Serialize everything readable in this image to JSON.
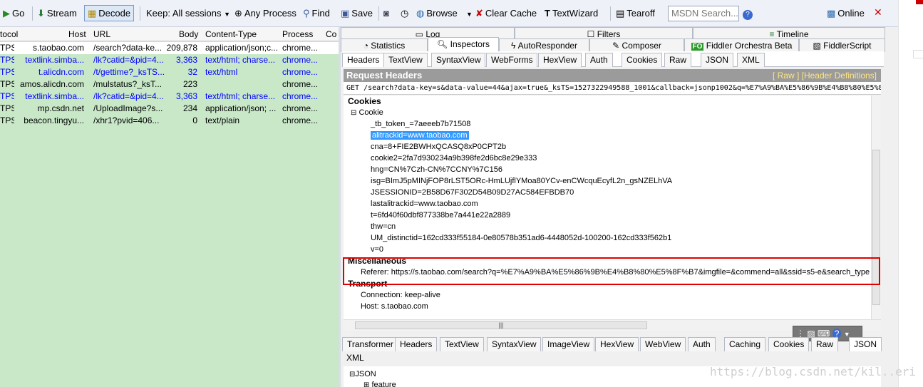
{
  "toolbar": {
    "go": "Go",
    "stream": "Stream",
    "decode": "Decode",
    "keep": "Keep: All sessions",
    "any_process": "Any Process",
    "find": "Find",
    "save": "Save",
    "browse": "Browse",
    "clear_cache": "Clear Cache",
    "textwizard": "TextWizard",
    "tearoff": "Tearoff",
    "msdn_placeholder": "MSDN Search...",
    "online": "Online"
  },
  "sessions": {
    "columns": [
      "tocol",
      "Host",
      "URL",
      "Body",
      "Content-Type",
      "Process",
      "Co"
    ],
    "rows": [
      {
        "proto": "TPS",
        "host": "s.taobao.com",
        "url": "/search?data-ke...",
        "body": "209,878",
        "ctype": "application/json;c...",
        "process": "chrome...",
        "style": "white"
      },
      {
        "proto": "TPS",
        "host": "textlink.simba...",
        "url": "/lk?catid=&pid=4...",
        "body": "3,363",
        "ctype": "text/html; charse...",
        "process": "chrome...",
        "style": "blue"
      },
      {
        "proto": "TPS",
        "host": "t.alicdn.com",
        "url": "/t/gettime?_ksTS...",
        "body": "32",
        "ctype": "text/html",
        "process": "chrome...",
        "style": "blue"
      },
      {
        "proto": "TPS",
        "host": "amos.alicdn.com",
        "url": "/mulstatus?_ksT...",
        "body": "223",
        "ctype": "",
        "process": "chrome...",
        "style": "plain"
      },
      {
        "proto": "TPS",
        "host": "textlink.simba...",
        "url": "/lk?catid=&pid=4...",
        "body": "3,363",
        "ctype": "text/html; charse...",
        "process": "chrome...",
        "style": "blue"
      },
      {
        "proto": "TPS",
        "host": "mp.csdn.net",
        "url": "/UploadImage?s...",
        "body": "234",
        "ctype": "application/json; ...",
        "process": "chrome...",
        "style": "plain"
      },
      {
        "proto": "TPS",
        "host": "beacon.tingyu...",
        "url": "/xhr1?pvid=406...",
        "body": "0",
        "ctype": "text/plain",
        "process": "chrome...",
        "style": "plain"
      }
    ]
  },
  "top_tabs": {
    "row1": [
      "Log",
      "Filters",
      "Timeline"
    ],
    "row2": [
      "Statistics",
      "Inspectors",
      "AutoResponder",
      "Composer",
      "Fiddler Orchestra Beta",
      "FiddlerScript"
    ]
  },
  "request_tabs": [
    "Headers",
    "TextView",
    "SyntaxView",
    "WebForms",
    "HexView",
    "Auth",
    "Cookies",
    "Raw",
    "JSON",
    "XML"
  ],
  "request": {
    "title": "Request Headers",
    "links": "[ Raw ]   [Header Definitions]",
    "line": "GET /search?data-key=s&data-value=44&ajax=true&_ksTS=1527322949588_1001&callback=jsonp1002&q=%E7%A9%BA%E5%86%9B%E4%B8%80%E5%8",
    "cookies_header": "Cookies",
    "cookie_node": "Cookie",
    "cookies": [
      "_tb_token_=7aeeeb7b71508",
      "alitrackid=www.taobao.com",
      "cna=8+FIE2BWHxQCASQ8xP0CPT2b",
      "cookie2=2fa7d930234a9b398fe2d6bc8e29e333",
      "hng=CN%7Czh-CN%7CCNY%7C156",
      "isg=BImJ5pMINjFOP8rLST5ORc-HmLUjflYMoa80YCv-enCWcquEcyfL2n_gsNZELhVA",
      "JSESSIONID=2B58D67F302D54B09D27AC584EFBDB70",
      "lastalitrackid=www.taobao.com",
      "t=6fd40f60dbf877338be7a441e22a2889",
      "thw=cn",
      "UM_distinctid=162cd333f55184-0e80578b351ad6-4448052d-100200-162cd333f562b1",
      "v=0"
    ],
    "misc_header": "Miscellaneous",
    "referer": "Referer: https://s.taobao.com/search?q=%E7%A9%BA%E5%86%9B%E4%B8%80%E5%8F%B7&imgfile=&commend=all&ssid=s5-e&search_type",
    "transport_header": "Transport",
    "connection": "Connection: keep-alive",
    "host": "Host: s.taobao.com"
  },
  "response_tabs": [
    "Transformer",
    "Headers",
    "TextView",
    "SyntaxView",
    "ImageView",
    "HexView",
    "WebView",
    "Auth",
    "Caching",
    "Cookies",
    "Raw",
    "JSON",
    "XML"
  ],
  "response": {
    "json_node": "JSON",
    "feature_node": "feature"
  },
  "watermark": "https://blog.csdn.net/kil..eri"
}
